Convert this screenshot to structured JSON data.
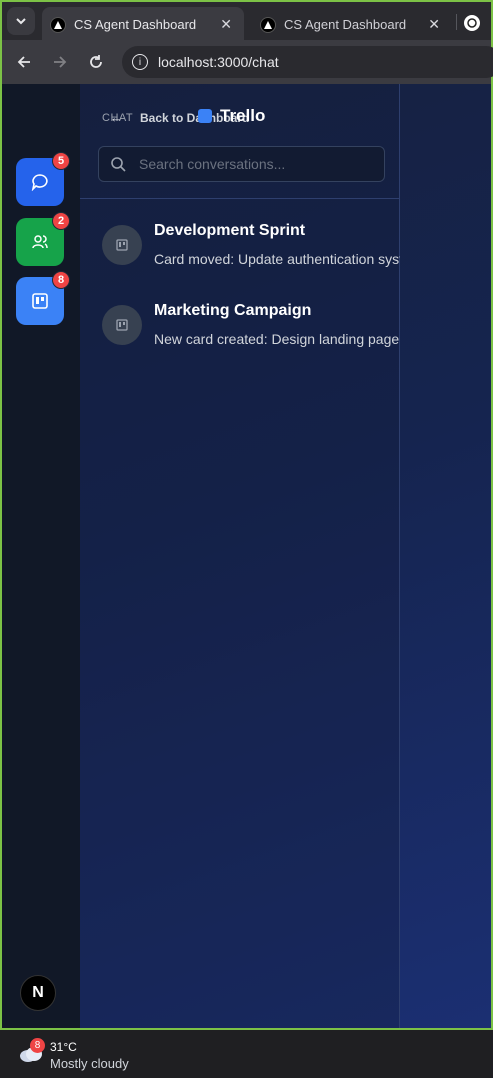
{
  "browser": {
    "tabs": [
      {
        "title": "CS Agent Dashboard",
        "active": true
      },
      {
        "title": "CS Agent Dashboard",
        "active": false
      }
    ],
    "url": "localhost:3000/chat"
  },
  "app": {
    "header": {
      "section_label": "CHAT",
      "back_label": "Back to Dashboard",
      "title": "Trello"
    },
    "rail": {
      "items": [
        {
          "name": "chat",
          "icon": "chat-bubble-icon",
          "badge": "5",
          "color": "#2563eb"
        },
        {
          "name": "contacts",
          "icon": "users-icon",
          "badge": "2",
          "color": "#16a34a"
        },
        {
          "name": "trello",
          "icon": "trello-icon",
          "badge": "8",
          "color": "#3b82f6"
        }
      ],
      "footer_logo": "N"
    },
    "search": {
      "placeholder": "Search conversations..."
    },
    "conversations": [
      {
        "title": "Development Sprint",
        "preview": "Card moved: Update authentication system"
      },
      {
        "title": "Marketing Campaign",
        "preview": "New card created: Design landing page"
      }
    ]
  },
  "taskbar": {
    "weather_badge": "8",
    "temperature": "31°C",
    "condition": "Mostly cloudy"
  }
}
